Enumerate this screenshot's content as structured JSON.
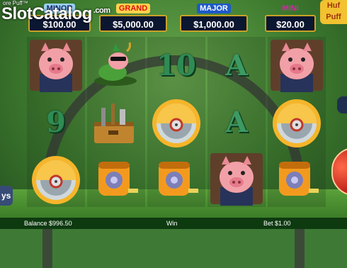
{
  "header": {
    "watermark": "SlotCatalog",
    "watermark_suffix": ".com",
    "subtitle": "ore Puff™"
  },
  "jackpots": [
    {
      "label": "MINOR",
      "value": "$100.00"
    },
    {
      "label": "GRAND",
      "value": "$5,000.00"
    },
    {
      "label": "MAJOR",
      "value": "$1,000.00"
    },
    {
      "label": "MINI",
      "value": "$20.00"
    }
  ],
  "logo_text": "Huf Puff",
  "reels": [
    [
      "pig-icon",
      "9",
      "saw-blade-icon"
    ],
    [
      "piggy-sunglasses-icon",
      "toolbox-icon",
      "tape-measure-icon"
    ],
    [
      "10",
      "saw-blade-icon",
      "tape-measure-icon"
    ],
    [
      "A",
      "A",
      "pig-icon"
    ],
    [
      "pig-icon",
      "saw-blade-icon",
      "tape-measure-icon"
    ]
  ],
  "left_tab": "ys",
  "bottom_bar": {
    "balance_label": "Balance",
    "balance_value": "$996.50",
    "win_label": "Win",
    "bet_label": "Bet",
    "bet_value": "$1.00"
  },
  "colors": {
    "reel_number_green": "#2f8b54",
    "jackpot_border": "#c9a227",
    "spin_red": "#b1120c"
  }
}
